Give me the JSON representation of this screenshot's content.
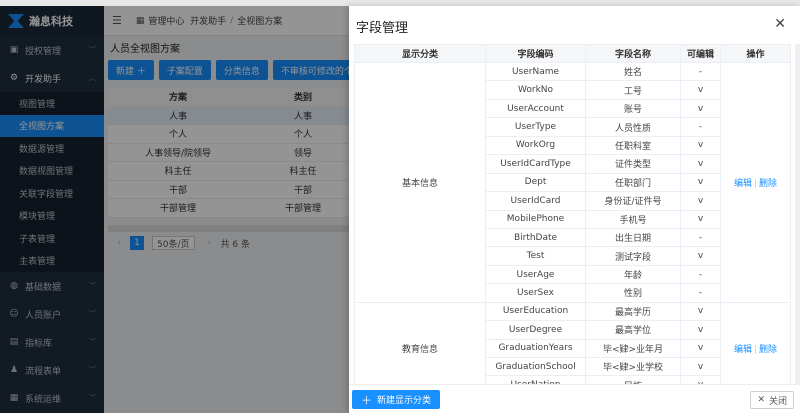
{
  "app": {
    "logo_text": "瀚息科技"
  },
  "header": {
    "crumb_root": "管理中心",
    "crumb_mid": "开发助手",
    "crumb_leaf": "全视图方案"
  },
  "sidebar": {
    "groups": [
      {
        "label": "授权管理",
        "icon": "badge-icon"
      },
      {
        "label": "开发助手",
        "icon": "gear-icon"
      }
    ],
    "subitems": [
      "视图管理",
      "全视图方案",
      "数据源管理",
      "数据视图管理",
      "关联字段管理",
      "模块管理",
      "子表管理",
      "主表管理"
    ],
    "lower_groups": [
      {
        "label": "基础数据",
        "icon": "globe-icon"
      },
      {
        "label": "人员账户",
        "icon": "user-icon"
      },
      {
        "label": "指标库",
        "icon": "inbox-icon"
      },
      {
        "label": "流程表单",
        "icon": "person-icon"
      },
      {
        "label": "系统运维",
        "icon": "server-icon"
      }
    ]
  },
  "main": {
    "title": "人员全视图方案",
    "buttons": [
      "新建 ＋",
      "子案配置",
      "分类信息",
      "不审核可修改的个"
    ],
    "table": {
      "headers": [
        "方案",
        "类别"
      ],
      "rows": [
        [
          "人事",
          "人事"
        ],
        [
          "个人",
          "个人"
        ],
        [
          "人事领导/院领导",
          "领导"
        ],
        [
          "科主任",
          "科主任"
        ],
        [
          "干部",
          "干部"
        ],
        [
          "干部管理",
          "干部管理"
        ]
      ]
    },
    "pager": {
      "page": "1",
      "size": "50条/页",
      "total": "共 6 条"
    }
  },
  "drawer": {
    "title": "字段管理",
    "headers": [
      "显示分类",
      "字段编码",
      "字段名称",
      "可编辑",
      "操作"
    ],
    "edit_label": "编辑",
    "delete_label": "删除",
    "groups": [
      {
        "name": "基本信息",
        "rows": [
          [
            "UserName",
            "姓名",
            "-"
          ],
          [
            "WorkNo",
            "工号",
            "v"
          ],
          [
            "UserAccount",
            "账号",
            "v"
          ],
          [
            "UserType",
            "人员性质",
            "-"
          ],
          [
            "WorkOrg",
            "任职科室",
            "v"
          ],
          [
            "UserIdCardType",
            "证件类型",
            "v"
          ],
          [
            "Dept",
            "任职部门",
            "v"
          ],
          [
            "UserIdCard",
            "身份证/证件号",
            "v"
          ],
          [
            "MobilePhone",
            "手机号",
            "v"
          ],
          [
            "BirthDate",
            "出生日期",
            "-"
          ],
          [
            "Test",
            "测试字段",
            "v"
          ],
          [
            "UserAge",
            "年龄",
            "-"
          ],
          [
            "UserSex",
            "性别",
            "-"
          ]
        ]
      },
      {
        "name": "教育信息",
        "rows": [
          [
            "UserEducation",
            "最高学历",
            "v"
          ],
          [
            "UserDegree",
            "最高学位",
            "v"
          ],
          [
            "GraduationYears",
            "毕<肄>业年月",
            "v"
          ],
          [
            "GraduationSchool",
            "毕<肄>业学校",
            "v"
          ],
          [
            "UserNation",
            "民族",
            "v"
          ]
        ]
      }
    ],
    "new_button": "新建显示分类",
    "close_button": "关闭"
  }
}
